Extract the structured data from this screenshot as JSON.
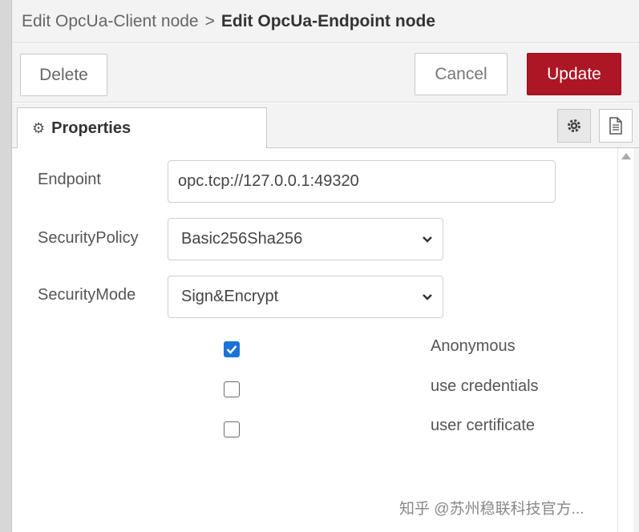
{
  "breadcrumb": {
    "parent": "Edit OpcUa-Client node",
    "separator": ">",
    "current": "Edit OpcUa-Endpoint node"
  },
  "toolbar": {
    "delete_label": "Delete",
    "cancel_label": "Cancel",
    "update_label": "Update"
  },
  "tabs": {
    "properties_label": "Properties",
    "icons": [
      "gear-icon",
      "document-icon"
    ]
  },
  "form": {
    "endpoint_label": "Endpoint",
    "endpoint_value": "opc.tcp://127.0.0.1:49320",
    "security_policy_label": "SecurityPolicy",
    "security_policy_value": "Basic256Sha256",
    "security_mode_label": "SecurityMode",
    "security_mode_value": "Sign&Encrypt",
    "checkboxes": [
      {
        "label": "Anonymous",
        "checked": true
      },
      {
        "label": "use credentials",
        "checked": false
      },
      {
        "label": "user certificate",
        "checked": false
      }
    ]
  },
  "watermark": "知乎 @苏州稳联科技官方...",
  "colors": {
    "update_button": "#ad1625",
    "checkbox_checked": "#1a73d9",
    "header_background": "#f3f3f3"
  }
}
